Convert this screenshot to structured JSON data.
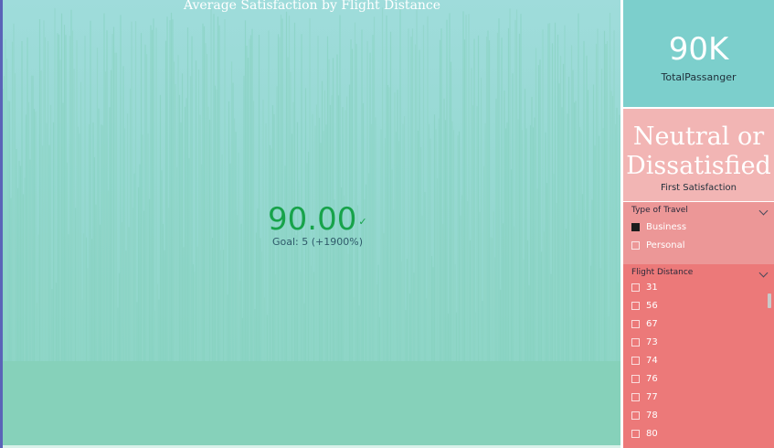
{
  "chart": {
    "title": "Average Satisfaction by Flight Distance",
    "kpi_value": "90.00",
    "kpi_goal": "Goal: 5 (+1900%)",
    "colors": {
      "fill": "#87d1bb",
      "kpi": "#17a34a"
    }
  },
  "cards": {
    "total": {
      "value": "90K",
      "label": "TotalPassanger"
    },
    "first": {
      "value": "Neutral or Dissatisfied",
      "label": "First Satisfaction"
    }
  },
  "slicers": {
    "travel": {
      "title": "Type of Travel",
      "options": [
        {
          "label": "Business",
          "checked": true
        },
        {
          "label": "Personal",
          "checked": false
        }
      ]
    },
    "distance": {
      "title": "Flight Distance",
      "options": [
        {
          "label": "31"
        },
        {
          "label": "56"
        },
        {
          "label": "67"
        },
        {
          "label": "73"
        },
        {
          "label": "74"
        },
        {
          "label": "76"
        },
        {
          "label": "77"
        },
        {
          "label": "78"
        },
        {
          "label": "80"
        }
      ]
    }
  },
  "icons": {
    "kpi_status": "checkmark-icon",
    "collapse": "chevron-down-icon",
    "scroll": "scrollbar-thumb"
  }
}
